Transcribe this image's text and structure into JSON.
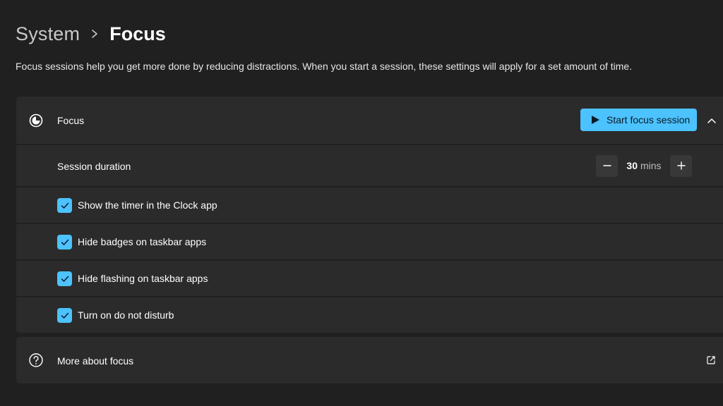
{
  "breadcrumb": {
    "parent": "System",
    "current": "Focus"
  },
  "description": "Focus sessions help you get more done by reducing distractions. When you start a session, these settings will apply for a set amount of time.",
  "focus": {
    "icon": "focus-icon",
    "label": "Focus",
    "start_button_label": "Start focus session",
    "collapse_icon": "chevron-up-icon"
  },
  "session_duration": {
    "label": "Session duration",
    "value": "30",
    "unit": "mins",
    "decrement_icon": "minus-icon",
    "increment_icon": "plus-icon"
  },
  "options": [
    {
      "label": "Show the timer in the Clock app",
      "checked": true
    },
    {
      "label": "Hide badges on taskbar apps",
      "checked": true
    },
    {
      "label": "Hide flashing on taskbar apps",
      "checked": true
    },
    {
      "label": "Turn on do not disturb",
      "checked": true
    }
  ],
  "more": {
    "icon": "help-circle-icon",
    "label": "More about focus",
    "link_icon": "external-link-icon"
  },
  "colors": {
    "background": "#202020",
    "card": "#2b2b2b",
    "accent": "#4cc2ff"
  }
}
